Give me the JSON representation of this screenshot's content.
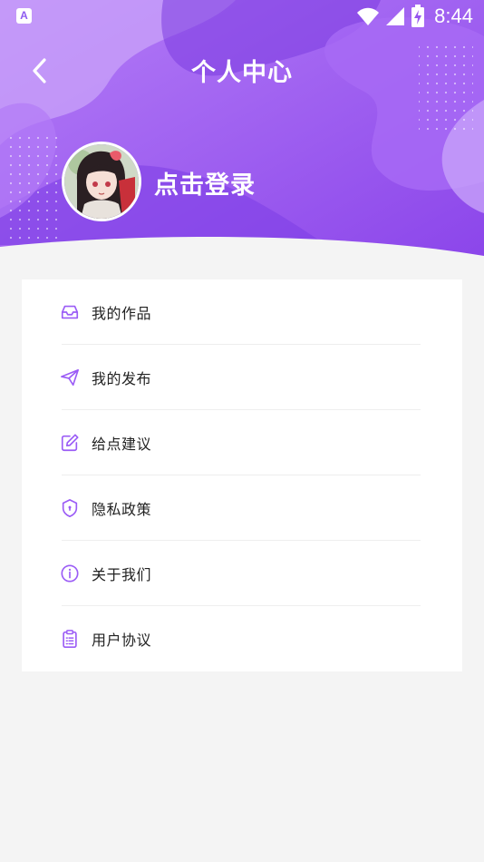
{
  "status_bar": {
    "app_indicator": "A",
    "time": "8:44"
  },
  "header": {
    "title": "个人中心",
    "login_text": "点击登录"
  },
  "menu": {
    "items": [
      {
        "label": "我的作品",
        "icon": "inbox-icon"
      },
      {
        "label": "我的发布",
        "icon": "send-icon"
      },
      {
        "label": "给点建议",
        "icon": "edit-icon"
      },
      {
        "label": "隐私政策",
        "icon": "shield-icon"
      },
      {
        "label": "关于我们",
        "icon": "info-icon"
      },
      {
        "label": "用户协议",
        "icon": "clipboard-icon"
      }
    ]
  },
  "colors": {
    "accent": "#9b5cf6",
    "header_dark": "#7e3fe6",
    "header_light": "#b98af8",
    "background": "#f4f4f4"
  }
}
